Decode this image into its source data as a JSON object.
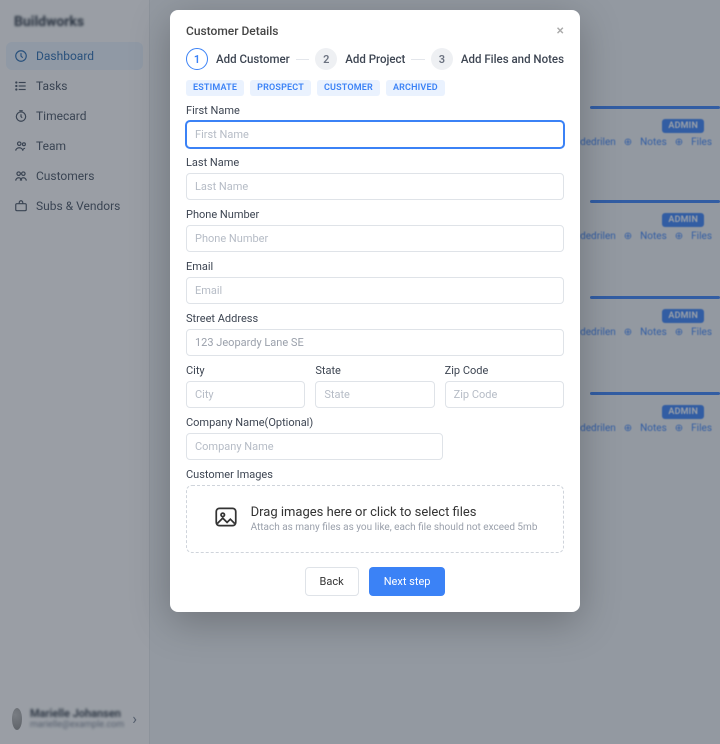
{
  "brand": "Buildworks",
  "sidebar": {
    "items": [
      {
        "label": "Dashboard"
      },
      {
        "label": "Tasks"
      },
      {
        "label": "Timecard"
      },
      {
        "label": "Team"
      },
      {
        "label": "Customers"
      },
      {
        "label": "Subs & Vendors"
      }
    ],
    "user": {
      "name": "Marielle Johansen",
      "email": "marielle@example.com"
    }
  },
  "bg_cards": {
    "admin_badge": "ADMIN",
    "links": [
      "Hudedrilen",
      "Notes",
      "Files"
    ]
  },
  "modal": {
    "title": "Customer Details",
    "steps": [
      {
        "num": "1",
        "label": "Add Customer"
      },
      {
        "num": "2",
        "label": "Add Project"
      },
      {
        "num": "3",
        "label": "Add Files and Notes"
      }
    ],
    "tags": [
      "ESTIMATE",
      "PROSPECT",
      "CUSTOMER",
      "ARCHIVED"
    ],
    "fields": {
      "first_name": {
        "label": "First Name",
        "placeholder": "First Name",
        "value": ""
      },
      "last_name": {
        "label": "Last Name",
        "placeholder": "Last Name",
        "value": ""
      },
      "phone": {
        "label": "Phone Number",
        "placeholder": "Phone Number",
        "value": ""
      },
      "email": {
        "label": "Email",
        "placeholder": "Email",
        "value": ""
      },
      "street": {
        "label": "Street Address",
        "placeholder": "",
        "value": "123 Jeopardy Lane SE"
      },
      "city": {
        "label": "City",
        "placeholder": "City",
        "value": ""
      },
      "state": {
        "label": "State",
        "placeholder": "State",
        "value": ""
      },
      "zip": {
        "label": "Zip Code",
        "placeholder": "Zip Code",
        "value": ""
      },
      "company": {
        "label": "Company Name(Optional)",
        "placeholder": "Company Name",
        "value": ""
      }
    },
    "uploader": {
      "section_label": "Customer Images",
      "title": "Drag images here or click to select files",
      "sub": "Attach as many files as you like, each file should not exceed 5mb"
    },
    "actions": {
      "back": "Back",
      "next": "Next step"
    }
  }
}
